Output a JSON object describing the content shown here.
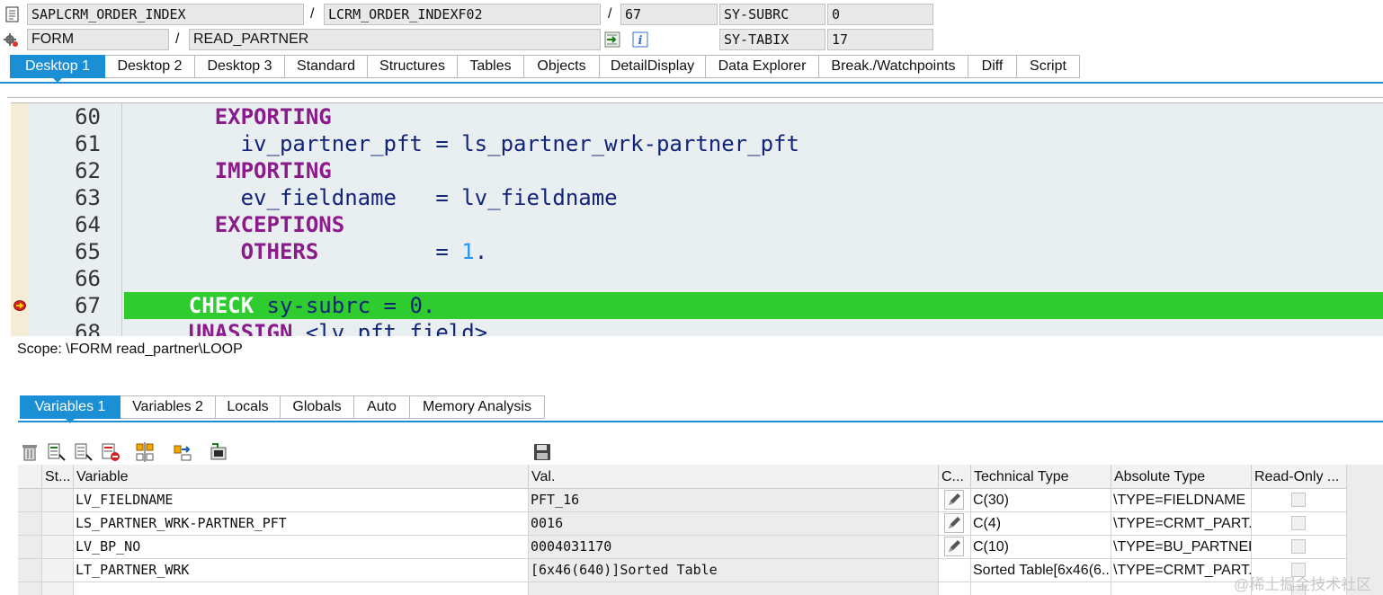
{
  "header": {
    "program": "SAPLCRM_ORDER_INDEX",
    "include": "LCRM_ORDER_INDEXF02",
    "line": "67",
    "event_type": "FORM",
    "event_name": "READ_PARTNER",
    "sysvars": [
      {
        "name": "SY-SUBRC",
        "value": "0"
      },
      {
        "name": "SY-TABIX",
        "value": "17"
      }
    ],
    "separator": "/"
  },
  "desktop_tabs": [
    {
      "label": "Desktop 1",
      "active": true
    },
    {
      "label": "Desktop 2"
    },
    {
      "label": "Desktop 3"
    },
    {
      "label": "Standard"
    },
    {
      "label": "Structures"
    },
    {
      "label": "Tables"
    },
    {
      "label": "Objects"
    },
    {
      "label": "DetailDisplay"
    },
    {
      "label": "Data Explorer"
    },
    {
      "label": "Break./Watchpoints"
    },
    {
      "label": "Diff"
    },
    {
      "label": "Script"
    }
  ],
  "code": {
    "lines": [
      {
        "n": "60",
        "indent": "      ",
        "parts": [
          {
            "t": "EXPORTING",
            "c": "kw"
          }
        ]
      },
      {
        "n": "61",
        "indent": "        ",
        "parts": [
          {
            "t": "iv_partner_pft = ls_partner_wrk-partner_pft",
            "c": "op"
          }
        ]
      },
      {
        "n": "62",
        "indent": "      ",
        "parts": [
          {
            "t": "IMPORTING",
            "c": "kw"
          }
        ]
      },
      {
        "n": "63",
        "indent": "        ",
        "parts": [
          {
            "t": "ev_fieldname   = lv_fieldname",
            "c": "op"
          }
        ]
      },
      {
        "n": "64",
        "indent": "      ",
        "parts": [
          {
            "t": "EXCEPTIONS",
            "c": "kw"
          }
        ]
      },
      {
        "n": "65",
        "indent": "        ",
        "parts": [
          {
            "t": "OTHERS",
            "c": "kw"
          },
          {
            "t": "         = ",
            "c": "op"
          },
          {
            "t": "1",
            "c": "num"
          },
          {
            "t": ".",
            "c": "op"
          }
        ]
      },
      {
        "n": "66",
        "indent": "",
        "parts": []
      },
      {
        "n": "67",
        "indent": "    ",
        "current": true,
        "parts": [
          {
            "t": "CHECK",
            "c": "kw"
          },
          {
            "t": " sy-subrc = 0.",
            "c": "op"
          }
        ]
      },
      {
        "n": "68",
        "indent": "    ",
        "parts": [
          {
            "t": "UNASSIGN",
            "c": "kw"
          },
          {
            "t": " <lv_pft_field>",
            "c": "op"
          }
        ]
      }
    ]
  },
  "scope": "Scope: \\FORM read_partner\\LOOP",
  "variable_tabs": [
    {
      "label": "Variables 1",
      "active": true
    },
    {
      "label": "Variables 2"
    },
    {
      "label": "Locals"
    },
    {
      "label": "Globals"
    },
    {
      "label": "Auto"
    },
    {
      "label": "Memory Analysis"
    }
  ],
  "toolbar": {
    "icons": [
      "delete-icon",
      "insert-variable-icon",
      "append-variable-icon",
      "remove-variable-icon",
      "sort-icon",
      "transfer-icon",
      "export-icon",
      "save-icon"
    ]
  },
  "grid": {
    "columns": [
      "St...",
      "Variable",
      "Val.",
      "C...",
      "Technical Type",
      "Absolute Type",
      "Read-Only ..."
    ],
    "rows": [
      {
        "variable": "LV_FIELDNAME",
        "value": "PFT_16",
        "editable": true,
        "tech": "C(30)",
        "abs": "\\TYPE=FIELDNAME"
      },
      {
        "variable": "LS_PARTNER_WRK-PARTNER_PFT",
        "value": "0016",
        "editable": true,
        "tech": "C(4)",
        "abs": "\\TYPE=CRMT_PART..."
      },
      {
        "variable": "LV_BP_NO",
        "value": "0004031170",
        "editable": true,
        "tech": "C(10)",
        "abs": "\\TYPE=BU_PARTNER"
      },
      {
        "variable": "LT_PARTNER_WRK",
        "value": "[6x46(640)]Sorted Table",
        "editable": false,
        "tech": "Sorted Table[6x46(6...",
        "abs": "\\TYPE=CRMT_PART..."
      }
    ]
  },
  "watermark": "@稀土掘金技术社区"
}
